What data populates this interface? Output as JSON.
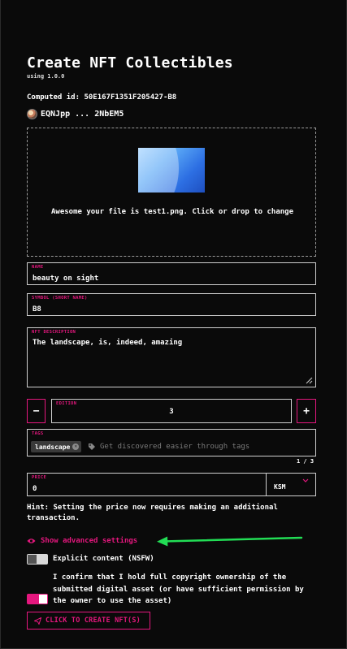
{
  "header": {
    "title": "Create NFT Collectibles",
    "version": "using 1.0.0",
    "computed_id": "Computed id: 50E167F1351F205427-B8",
    "account": "EQNJpp ... 2NbEM5"
  },
  "dropzone": {
    "message": "Awesome your file is test1.png. Click or drop to change"
  },
  "name": {
    "label": "NAME",
    "value": "beauty on sight"
  },
  "symbol": {
    "label": "SYMBOL (SHORT NAME)",
    "value": "B8"
  },
  "description": {
    "label": "NFT DESCRIPTION",
    "value": "The landscape, is, indeed, amazing"
  },
  "edition": {
    "label": "EDITION",
    "value": "3",
    "minus": "−",
    "plus": "+"
  },
  "tags": {
    "label": "TAGS",
    "chip": "landscape",
    "placeholder": "Get discovered easier through tags",
    "counter": "1 / 3"
  },
  "price": {
    "label": "PRICE",
    "value": "0",
    "currency": "KSM"
  },
  "hint": "Hint: Setting the price now requires making an additional transaction.",
  "advanced": {
    "label": "Show advanced settings"
  },
  "nsfw": {
    "label": "Explicit content (NSFW)",
    "enabled": false
  },
  "confirm": {
    "label": "I confirm that I hold full copyright ownership of the submitted digital asset (or have sufficient permission by the owner to use the asset)",
    "enabled": true
  },
  "submit": {
    "label": "CLICK TO CREATE NFT(S)"
  },
  "colors": {
    "accent": "#e5177e",
    "annotation_arrow": "#22dd55",
    "background": "#0a0a0a"
  },
  "icons": [
    "avatar",
    "image-thumbnail",
    "resize-handle-icon",
    "tag-icon",
    "chevron-down-icon",
    "eye-icon",
    "send-icon",
    "arrow-annotation"
  ]
}
